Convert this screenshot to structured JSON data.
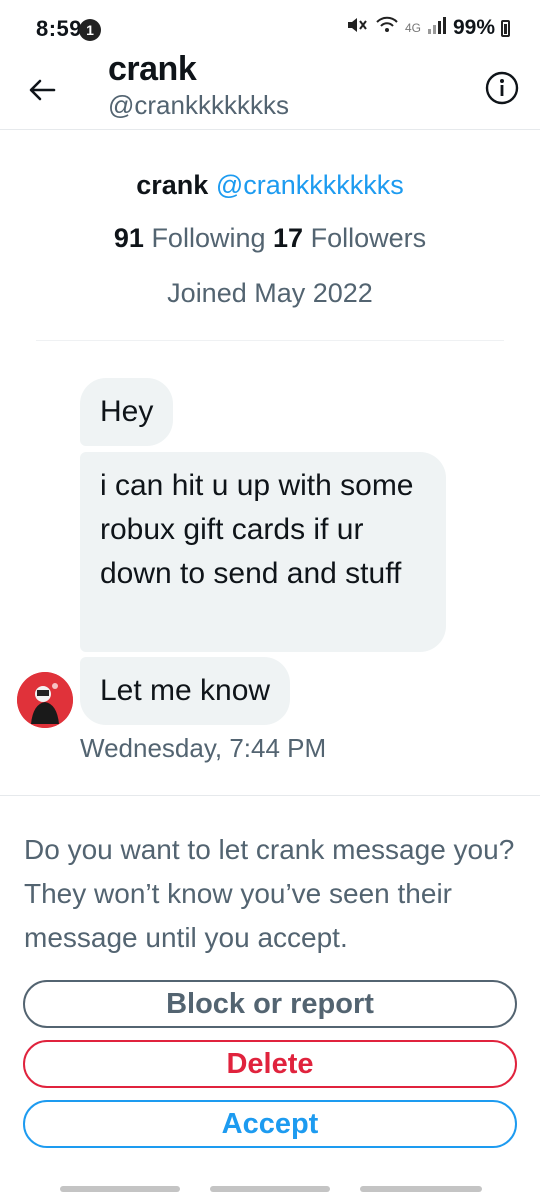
{
  "status_bar": {
    "time": "8:59",
    "notification_count": "1",
    "network": "4G",
    "battery": "99%",
    "icons": [
      "mute-vibrate-icon",
      "wifi-icon",
      "signal-icon",
      "battery-icon"
    ]
  },
  "header": {
    "name": "crank",
    "handle": "@crankkkkkkks",
    "icons": [
      "back-arrow-icon",
      "info-icon"
    ]
  },
  "profile": {
    "name": "crank",
    "handle": "@crankkkkkkks",
    "following_count": "91",
    "following_label": "Following",
    "followers_count": "17",
    "followers_label": "Followers",
    "joined": "Joined May 2022"
  },
  "messages": [
    {
      "text": "Hey"
    },
    {
      "text": "i can hit u up with some robux gift cards if ur down to send and stuff"
    },
    {
      "text": "Let me know"
    }
  ],
  "timestamp": "Wednesday, 7:44 PM",
  "request": {
    "prompt": "Do you want to let crank message you? They won’t know you’ve seen their message until you accept.",
    "block_label": "Block or report",
    "delete_label": "Delete",
    "accept_label": "Accept"
  },
  "colors": {
    "accent": "#1d9bf0",
    "danger": "#e0233d",
    "secondary_text": "#536471",
    "bubble_bg": "#eff3f4"
  }
}
